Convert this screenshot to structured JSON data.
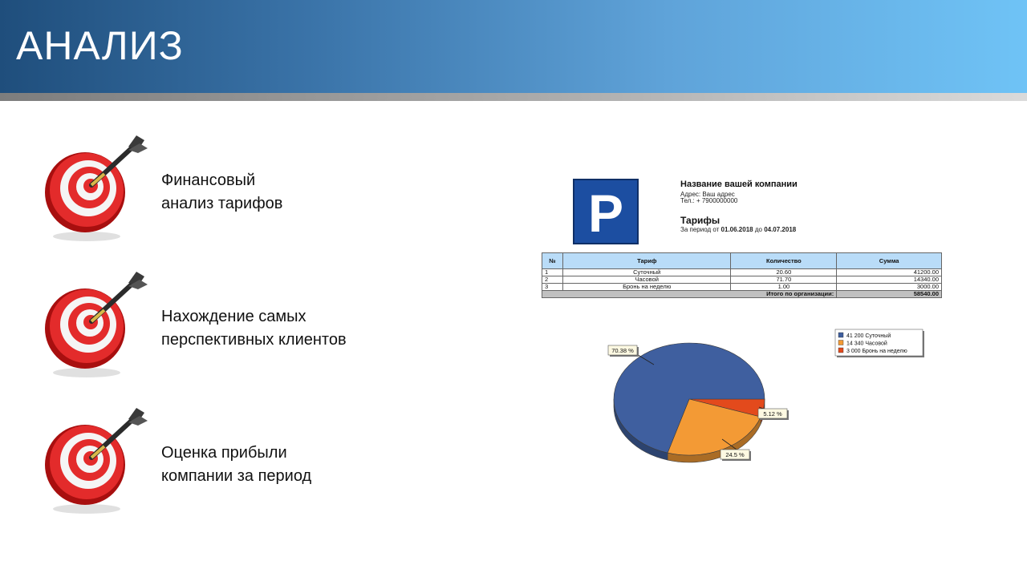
{
  "slide": {
    "title": "АНАЛИЗ"
  },
  "bullets": [
    {
      "lines": [
        "Финансовый",
        "анализ тарифов"
      ]
    },
    {
      "lines": [
        "Нахождение самых",
        "перспективных клиентов"
      ]
    },
    {
      "lines": [
        "Оценка прибыли",
        "компании за период"
      ]
    }
  ],
  "report": {
    "logo_letter": "P",
    "company_name": "Название вашей компании",
    "address": "Адрес: Ваш адрес",
    "phone": "Тел.: + 7900000000",
    "title": "Тарифы",
    "period_prefix": "За период от",
    "period_from": "01.06.2018",
    "period_mid": "до",
    "period_to": "04.07.2018",
    "table": {
      "headers": [
        "№",
        "Тариф",
        "Количество",
        "Сумма"
      ],
      "rows": [
        [
          "1",
          "Суточный",
          "20.60",
          "41200.00"
        ],
        [
          "2",
          "Часовой",
          "71.70",
          "14340.00"
        ],
        [
          "3",
          "Бронь на неделю",
          "1.00",
          "3000.00"
        ]
      ],
      "total_label": "Итого по организации:",
      "total_value": "58540.00"
    }
  },
  "chart_data": {
    "type": "pie",
    "labels": [
      "Суточный",
      "Часовой",
      "Бронь на неделю"
    ],
    "values": [
      41200,
      14340,
      3000
    ],
    "percent_labels": [
      "70.38 %",
      "24.5 %",
      "5.12 %"
    ],
    "legend_entries": [
      "41 200 Суточный",
      "14 340 Часовой",
      "3 000 Бронь на неделю"
    ],
    "colors": [
      "#3f5f9f",
      "#f39a35",
      "#e34a1c"
    ],
    "legend_position": "top-right"
  }
}
